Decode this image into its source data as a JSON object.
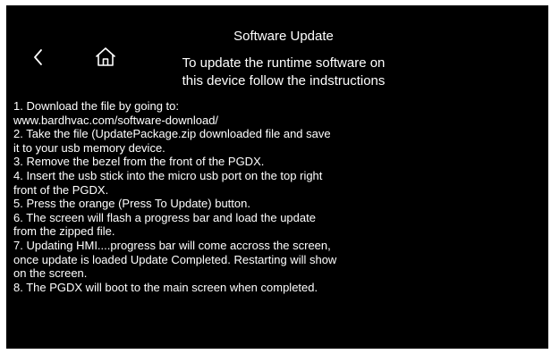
{
  "header": {
    "title": "Software Update",
    "subtitle_line1": "To update the runtime software on",
    "subtitle_line2": "this device follow the indstructions"
  },
  "nav": {
    "back_icon": "chevron-left-icon",
    "home_icon": "home-icon"
  },
  "instructions": {
    "lines": [
      "1. Download the file by going to:",
      "www.bardhvac.com/software-download/",
      "2. Take the file (UpdatePackage.zip downloaded file and save",
      "it to your usb memory device.",
      "3. Remove the bezel from the front of the PGDX.",
      "4. Insert the usb stick into the micro usb port on the top right",
      "front of the PGDX.",
      "5. Press the orange (Press To Update) button.",
      "6. The screen will flash a progress bar and load the update",
      "from the zipped file.",
      "7. Updating HMI....progress bar will come accross the screen,",
      "once update is loaded Update Completed. Restarting will show",
      "on the screen.",
      "8. The PGDX will boot to the main screen when completed."
    ]
  },
  "colors": {
    "background": "#000000",
    "text": "#ffffff"
  }
}
